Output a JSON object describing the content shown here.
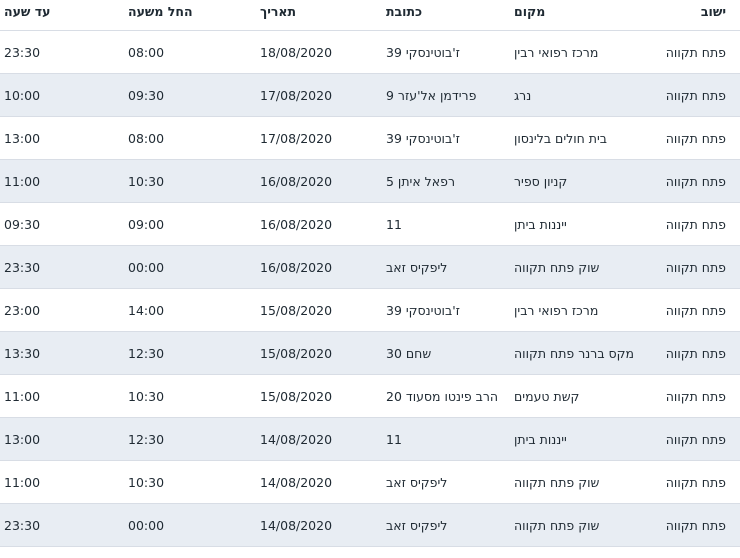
{
  "headers": {
    "city": "ישוב",
    "place": "מקום",
    "address": "כתובת",
    "date": "תאריך",
    "from": "החל משעה",
    "to": "עד שעה"
  },
  "rows": [
    {
      "city": "פתח תקווה",
      "place": "מרכז רפואי רבין",
      "address": "ז'בוטינסקי 39",
      "date": "18/08/2020",
      "from": "08:00",
      "to": "23:30"
    },
    {
      "city": "פתח תקווה",
      "place": "נרג",
      "address": "פרידמן אל'עזר 9",
      "date": "17/08/2020",
      "from": "09:30",
      "to": "10:00"
    },
    {
      "city": "פתח תקווה",
      "place": "בית חולים בלינסון",
      "address": "ז'בוטינסקי 39",
      "date": "17/08/2020",
      "from": "08:00",
      "to": "13:00"
    },
    {
      "city": "פתח תקווה",
      "place": "קניון ספיר",
      "address": "רפאל איתן 5",
      "date": "16/08/2020",
      "from": "10:30",
      "to": "11:00"
    },
    {
      "city": "פתח תקווה",
      "place": "ייננות ביתן",
      "address": "11",
      "date": "16/08/2020",
      "from": "09:00",
      "to": "09:30"
    },
    {
      "city": "פתח תקווה",
      "place": "שוק פתח תקווה",
      "address": "ליפקיס זאב",
      "date": "16/08/2020",
      "from": "00:00",
      "to": "23:30"
    },
    {
      "city": "פתח תקווה",
      "place": "מרכז רפואי רבין",
      "address": "ז'בוטינסקי 39",
      "date": "15/08/2020",
      "from": "14:00",
      "to": "23:00"
    },
    {
      "city": "פתח תקווה",
      "place": "מקס ברנר פתח תקווה",
      "address": "שחם 30",
      "date": "15/08/2020",
      "from": "12:30",
      "to": "13:30"
    },
    {
      "city": "פתח תקווה",
      "place": "קשת טעמים",
      "address": "הרב פינטו מסעוד 20",
      "date": "15/08/2020",
      "from": "10:30",
      "to": "11:00"
    },
    {
      "city": "פתח תקווה",
      "place": "ייננות ביתן",
      "address": "11",
      "date": "14/08/2020",
      "from": "12:30",
      "to": "13:00"
    },
    {
      "city": "פתח תקווה",
      "place": "שוק פתח תקווה",
      "address": "ליפקיס זאב",
      "date": "14/08/2020",
      "from": "10:30",
      "to": "11:00"
    },
    {
      "city": "פתח תקווה",
      "place": "שוק פתח תקווה",
      "address": "ליפקיס זאב",
      "date": "14/08/2020",
      "from": "00:00",
      "to": "23:30"
    }
  ]
}
